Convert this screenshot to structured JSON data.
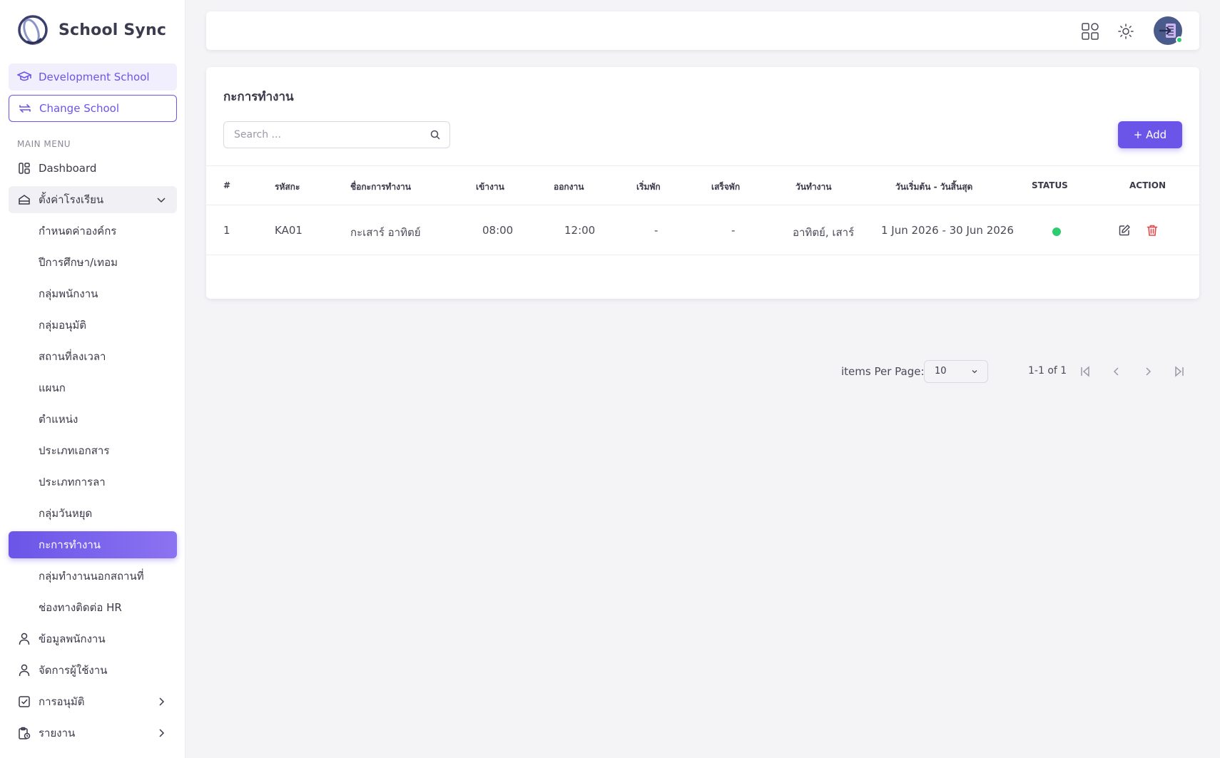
{
  "brand": {
    "name": "School Sync"
  },
  "school": {
    "current": "Development School",
    "change_label": "Change School"
  },
  "menu": {
    "header": "MAIN MENU",
    "dashboard": "Dashboard",
    "settings_group": "ตั้งค่าโรงเรียน",
    "settings_items": [
      "กำหนดค่าองค์กร",
      "ปีการศึกษา/เทอม",
      "กลุ่มพนักงาน",
      "กลุ่มอนุมัติ",
      "สถานที่ลงเวลา",
      "แผนก",
      "ตำแหน่ง",
      "ประเภทเอกสาร",
      "ประเภทการลา",
      "กลุ่มวันหยุด",
      "กะการทำงาน",
      "กลุ่มทำงานนอกสถานที่",
      "ช่องทางติดต่อ HR"
    ],
    "active_item": "กะการทำงาน",
    "employee_info": "ข้อมูลพนักงาน",
    "user_manage": "จัดการผู้ใช้งาน",
    "approval": "การอนุมัติ",
    "report": "รายงาน"
  },
  "page": {
    "title": "กะการทำงาน",
    "search_placeholder": "Search ...",
    "add_label": "+ Add"
  },
  "table": {
    "headers": [
      "#",
      "รหัสกะ",
      "ชื่อกะการทำงาน",
      "เข้างาน",
      "ออกงาน",
      "เริ่มพัก",
      "เสร็จพัก",
      "วันทำงาน",
      "วันเริ่มต้น - วันสิ้นสุด",
      "STATUS",
      "ACTION"
    ],
    "rows": [
      {
        "no": "1",
        "code": "KA01",
        "name": "กะเสาร์ อาทิตย์",
        "check_in": "08:00",
        "check_out": "12:00",
        "break_start": "-",
        "break_end": "-",
        "work_days": "อาทิตย์, เสาร์",
        "date_range": "1 Jun 2026 - 30 Jun 2026",
        "status": "active",
        "status_color": "#2ecc71"
      }
    ]
  },
  "pagination": {
    "items_per_page_label": "items Per Page:",
    "items_per_page": "10",
    "range": "1-1 of 1"
  },
  "colors": {
    "accent": "#6b55e8",
    "danger": "#e5484d",
    "success": "#2ecc71"
  }
}
